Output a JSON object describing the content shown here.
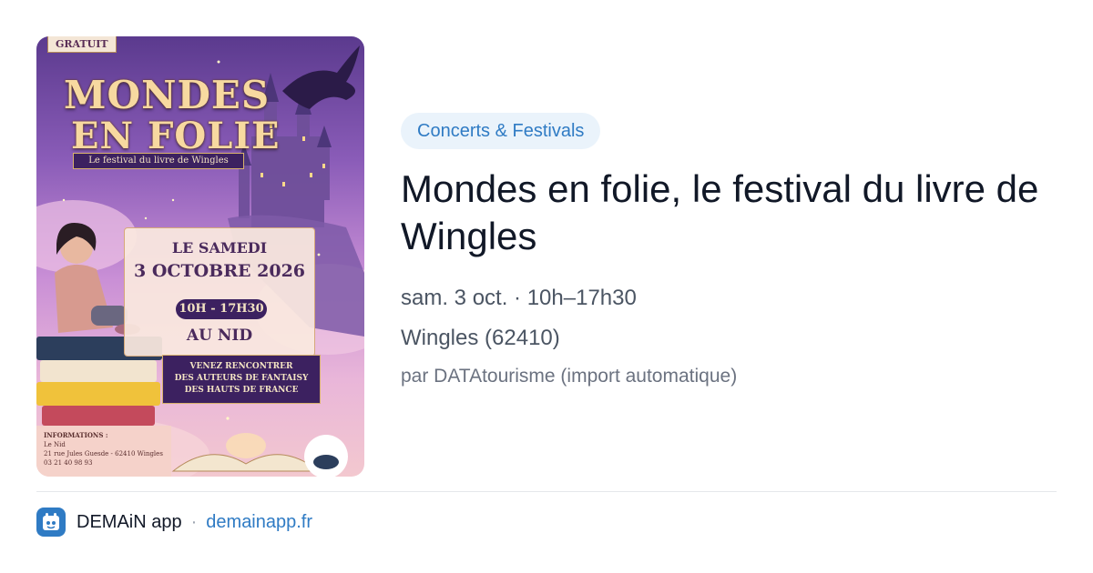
{
  "poster": {
    "badge": "GRATUIT",
    "title_line1": "MONDES",
    "title_line2": "EN FOLIE",
    "subtitle": "Le festival du livre de Wingles",
    "date_line1": "LE SAMEDI",
    "date_line2": "3 OCTOBRE 2026",
    "hours": "10H - 17H30",
    "venue": "AU NID",
    "meet_line1": "VENEZ RENCONTRER",
    "meet_line2": "DES AUTEURS DE FANTAISY",
    "meet_line3": "DES HAUTS DE FRANCE",
    "info_title": "INFORMATIONS :",
    "info_place": "Le Nid",
    "info_address": "21 rue Jules Guesde - 62410 Wingles",
    "info_phone": "03 21 40 98 93"
  },
  "event": {
    "category": "Concerts & Festivals",
    "title": "Mondes en folie, le festival du livre de Wingles",
    "when": "sam. 3 oct. · 10h–17h30",
    "where": "Wingles (62410)",
    "source": "par DATAtourisme (import automatique)"
  },
  "footer": {
    "app_name": "DEMAiN app",
    "separator": "·",
    "link": "demainapp.fr"
  },
  "colors": {
    "accent": "#2f7bc4",
    "badge_bg": "#eaf3fb",
    "poster_purple": "#3c2160"
  }
}
